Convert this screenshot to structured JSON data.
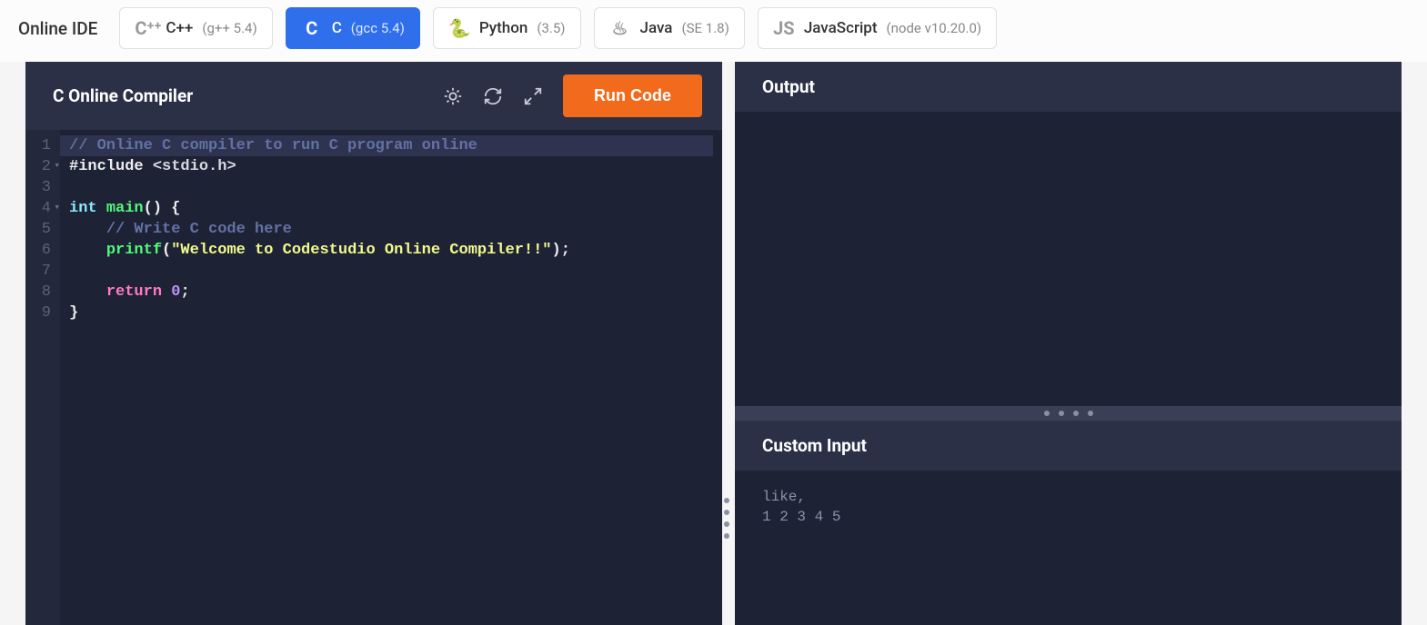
{
  "brand": "Online IDE",
  "languages": [
    {
      "icon": "C⁺⁺",
      "name": "C++",
      "version": "(g++ 5.4)",
      "active": false
    },
    {
      "icon": "C",
      "name": "C",
      "version": "(gcc 5.4)",
      "active": true
    },
    {
      "icon": "🐍",
      "name": "Python",
      "version": "(3.5)",
      "active": false
    },
    {
      "icon": "♨",
      "name": "Java",
      "version": "(SE 1.8)",
      "active": false
    },
    {
      "icon": "JS",
      "name": "JavaScript",
      "version": "(node v10.20.0)",
      "active": false
    }
  ],
  "editor": {
    "title": "C Online Compiler",
    "run_label": "Run Code",
    "lines": [
      {
        "n": 1,
        "fold": false,
        "hl": true,
        "tokens": [
          [
            "comment",
            "// Online C compiler to run C program online"
          ]
        ]
      },
      {
        "n": 2,
        "fold": true,
        "hl": false,
        "tokens": [
          [
            "preproc",
            "#include "
          ],
          [
            "inc",
            "<stdio.h>"
          ]
        ]
      },
      {
        "n": 3,
        "fold": false,
        "hl": false,
        "tokens": []
      },
      {
        "n": 4,
        "fold": true,
        "hl": false,
        "tokens": [
          [
            "type",
            "int "
          ],
          [
            "func",
            "main"
          ],
          [
            "plain",
            "() {"
          ]
        ]
      },
      {
        "n": 5,
        "fold": false,
        "hl": false,
        "tokens": [
          [
            "plain",
            "    "
          ],
          [
            "comment",
            "// Write C code here"
          ]
        ]
      },
      {
        "n": 6,
        "fold": false,
        "hl": false,
        "tokens": [
          [
            "plain",
            "    "
          ],
          [
            "call",
            "printf"
          ],
          [
            "plain",
            "("
          ],
          [
            "string",
            "\"Welcome to Codestudio Online Compiler!!\""
          ],
          [
            "plain",
            ");"
          ]
        ]
      },
      {
        "n": 7,
        "fold": false,
        "hl": false,
        "tokens": []
      },
      {
        "n": 8,
        "fold": false,
        "hl": false,
        "tokens": [
          [
            "plain",
            "    "
          ],
          [
            "keyword",
            "return "
          ],
          [
            "number",
            "0"
          ],
          [
            "plain",
            ";"
          ]
        ]
      },
      {
        "n": 9,
        "fold": false,
        "hl": false,
        "tokens": [
          [
            "plain",
            "}"
          ]
        ]
      }
    ]
  },
  "output": {
    "title": "Output",
    "content": ""
  },
  "custom_input": {
    "title": "Custom Input",
    "content": "like,\n1 2 3 4 5"
  }
}
